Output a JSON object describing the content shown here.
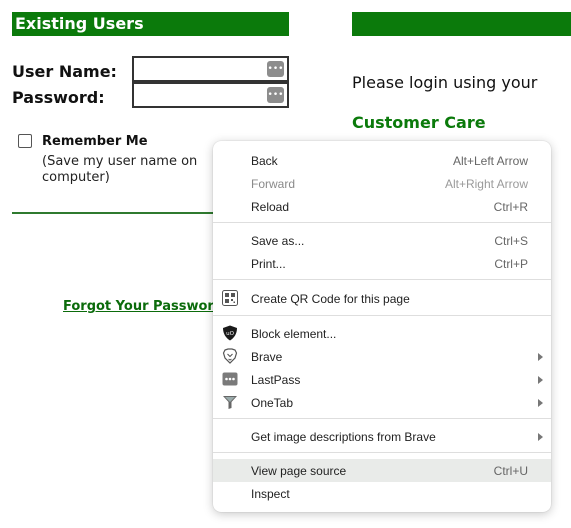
{
  "login": {
    "section_title": "Existing Users",
    "username_label": "User Name:",
    "password_label": "Password:",
    "username_value": "",
    "password_value": "",
    "remember_label": "Remember Me",
    "remember_sub": "(Save my user name on computer)",
    "forgot_link": "Forgot Your Password?"
  },
  "right_panel": {
    "please_text": "Please login using your",
    "customer_care": "Customer Care"
  },
  "context_menu": {
    "items": [
      {
        "label": "Back",
        "shortcut": "Alt+Left Arrow"
      },
      {
        "label": "Forward",
        "shortcut": "Alt+Right Arrow"
      },
      {
        "label": "Reload",
        "shortcut": "Ctrl+R"
      },
      {
        "label": "Save as...",
        "shortcut": "Ctrl+S"
      },
      {
        "label": "Print...",
        "shortcut": "Ctrl+P"
      },
      {
        "label": "Create QR Code for this page",
        "icon": "qr-code-icon"
      },
      {
        "label": "Block element...",
        "icon": "ublock-origin-icon"
      },
      {
        "label": "Brave",
        "icon": "brave-lion-icon"
      },
      {
        "label": "LastPass",
        "icon": "lastpass-icon"
      },
      {
        "label": "OneTab",
        "icon": "onetab-funnel-icon"
      },
      {
        "label": "Get image descriptions from Brave"
      },
      {
        "label": "View page source",
        "shortcut": "Ctrl+U"
      },
      {
        "label": "Inspect"
      }
    ]
  },
  "colors": {
    "brand_green": "#0b7a0b",
    "menu_highlight": "#e9ebe9"
  }
}
